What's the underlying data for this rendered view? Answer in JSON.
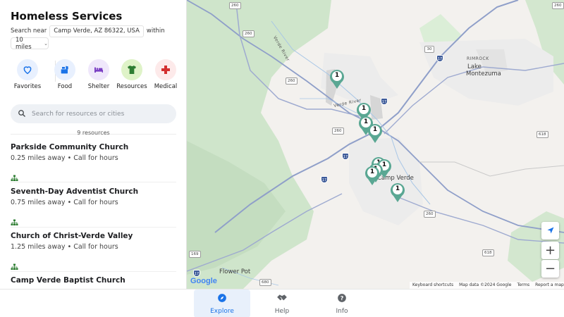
{
  "app": {
    "title": "Homeless Services"
  },
  "search_near": {
    "prefix": "Search near",
    "location": "Camp Verde, AZ 86322, USA",
    "suffix": "within",
    "radius": "10 miles"
  },
  "categories": [
    {
      "label": "Favorites",
      "icon": "heart-icon",
      "color": "#1a73e8",
      "bg": "#e8f0fe"
    },
    {
      "label": "Food",
      "icon": "food-icon",
      "color": "#1a73e8",
      "bg": "#e8f0fe"
    },
    {
      "label": "Shelter",
      "icon": "bed-icon",
      "color": "#7b3fc4",
      "bg": "#efe7fb"
    },
    {
      "label": "Resources",
      "icon": "shirt-icon",
      "color": "#2e7d32",
      "bg": "#dff3c8"
    },
    {
      "label": "Medical",
      "icon": "medical-cross-icon",
      "color": "#d32f2f",
      "bg": "#fdeaea"
    }
  ],
  "search": {
    "placeholder": "Search for resources or cities"
  },
  "results": {
    "count_label": "9 resources",
    "items": [
      {
        "name": "Parkside Community Church",
        "meta": "0.25 miles away • Call for hours"
      },
      {
        "name": "Seventh-Day Adventist Church",
        "meta": "0.75 miles away • Call for hours"
      },
      {
        "name": "Church of Christ-Verde Valley",
        "meta": "1.25 miles away • Call for hours"
      },
      {
        "name": "Camp Verde Baptist Church",
        "meta": ""
      }
    ]
  },
  "map": {
    "places": [
      "Lake",
      "Montezuma",
      "Camp Verde",
      "Flower Pot",
      "RIMROCK",
      "Verde River",
      "Verde River"
    ],
    "route_shields": [
      "260",
      "260",
      "260",
      "260",
      "260",
      "30",
      "618",
      "169",
      "680",
      "618",
      "260"
    ],
    "interstate_shields": [
      "17",
      "17",
      "17",
      "17",
      "17"
    ],
    "pins": [
      "1",
      "1",
      "1",
      "1",
      "1",
      "1",
      "1",
      "1",
      "1"
    ],
    "brand": "Google",
    "attribution": [
      "Keyboard shortcuts",
      "Map data ©2024 Google",
      "Terms",
      "Report a map error"
    ],
    "colors": {
      "pin": "#5aa793",
      "road": "#8f9fc9",
      "green": "#cfe5cb",
      "urban": "#e2e2e2"
    }
  },
  "nav": {
    "tabs": [
      {
        "label": "Explore",
        "icon": "compass-icon",
        "active": true
      },
      {
        "label": "Help",
        "icon": "handshake-icon",
        "active": false
      },
      {
        "label": "Info",
        "icon": "help-circle-icon",
        "active": false
      }
    ]
  }
}
